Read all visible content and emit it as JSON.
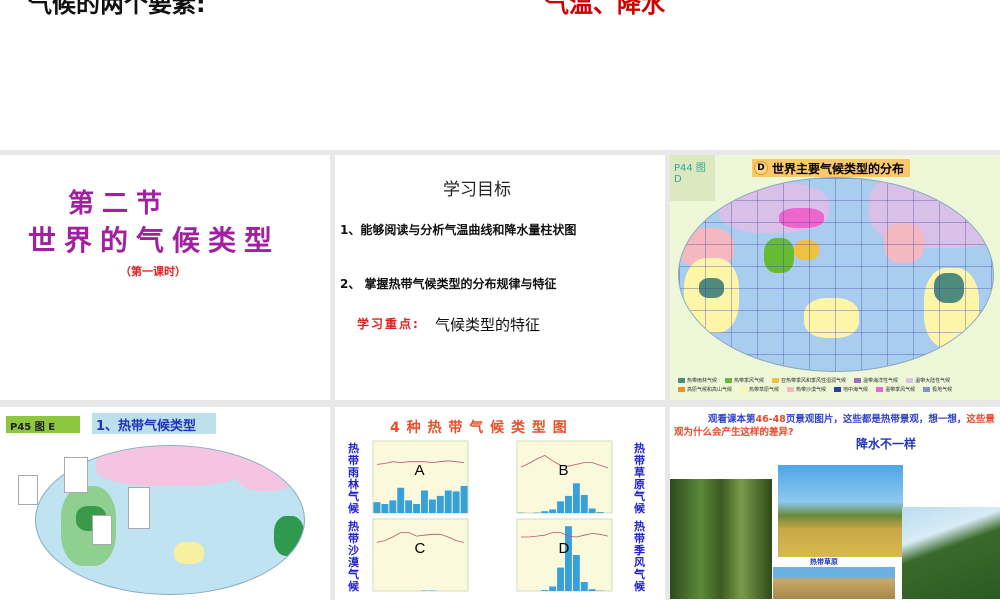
{
  "top_slide": {
    "text_left": "气候的两个要素:",
    "text_right": "气温、降水"
  },
  "slide1": {
    "line1": "第二节",
    "line2": "世界的气候类型",
    "subtitle": "（第一课时）"
  },
  "slide2": {
    "heading": "学习目标",
    "goal1": "1、能够阅读与分析气温曲线和降水量柱状图",
    "goal2": "2、 掌握热带气候类型的分布规律与特征",
    "focus_label": "学习重点:",
    "focus_text": "气候类型的特征"
  },
  "slide3": {
    "page_ref": "P44 图 D",
    "badge": "D",
    "title": "世界主要气候类型的分布",
    "legend": [
      {
        "label": "热带雨林气候",
        "color": "#4f8a7a"
      },
      {
        "label": "热带季风气候",
        "color": "#66bb33"
      },
      {
        "label": "亚热带季风和季风性湿润气候",
        "color": "#f0c040"
      },
      {
        "label": "温带海洋性气候",
        "color": "#9a6fc0"
      },
      {
        "label": "温带大陆性气候",
        "color": "#d8c0e8"
      },
      {
        "label": "高原气候和高山气候",
        "color": "#e8902a"
      },
      {
        "label": "热带草原气候",
        "color": "#fdf5a8"
      },
      {
        "label": "热带沙漠气候",
        "color": "#f5b8c0"
      },
      {
        "label": "地中海气候",
        "color": "#2a3fa0"
      },
      {
        "label": "温带季风气候",
        "color": "#ee66cc"
      },
      {
        "label": "极地气候",
        "color": "#8890c8"
      }
    ]
  },
  "slide4": {
    "page_ref": "P45 图 E",
    "title": "1、热带气候类型"
  },
  "slide5": {
    "title": "4 种 热 带 气 候 类 型 图",
    "labels": {
      "a": "热带雨林气候",
      "b": "热带草原气候",
      "c": "热带沙漠气候",
      "d": "热带季风气候"
    },
    "chart_data": [
      {
        "type": "bar",
        "name": "A",
        "values": [
          120,
          100,
          140,
          280,
          140,
          100,
          250,
          150,
          190,
          250,
          240,
          300
        ],
        "temp": [
          24,
          25,
          27,
          26,
          27,
          27,
          27,
          26,
          27,
          28,
          27,
          26
        ]
      },
      {
        "type": "bar",
        "name": "B",
        "values": [
          5,
          0,
          5,
          20,
          40,
          130,
          190,
          330,
          200,
          50,
          10,
          0
        ],
        "temp": [
          21,
          25,
          30,
          34,
          28,
          23,
          22,
          24,
          26,
          26,
          23,
          20
        ]
      },
      {
        "type": "bar",
        "name": "C",
        "values": [
          0,
          0,
          0,
          0,
          0,
          0,
          5,
          5,
          0,
          0,
          0,
          0
        ],
        "temp": [
          24,
          26,
          30,
          35,
          35,
          31,
          32,
          33,
          33,
          30,
          26,
          24
        ]
      },
      {
        "type": "bar",
        "name": "D",
        "values": [
          0,
          0,
          0,
          10,
          50,
          260,
          720,
          400,
          100,
          20,
          5,
          0
        ],
        "temp": [
          30,
          30,
          31,
          32,
          35,
          35,
          31,
          30,
          32,
          34,
          33,
          31
        ]
      }
    ]
  },
  "slide6": {
    "text_part1": "观看课本第",
    "pages": "46-48",
    "text_part2": "页景观图片，这些都是热带景观，想一想，",
    "text_red": "这些景观为什么会产生这样的差异?",
    "answer": "降水不一样",
    "caption": "热带草原"
  }
}
